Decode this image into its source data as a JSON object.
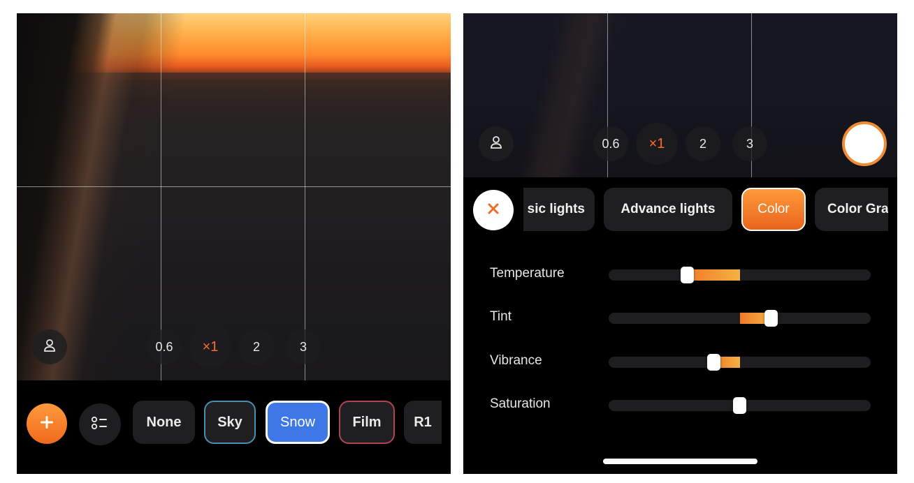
{
  "left": {
    "camera": {
      "user_icon": "person-icon",
      "zoom_levels": [
        "0.6",
        "×1",
        "2",
        "3"
      ],
      "active_zoom": "×1"
    },
    "bottom_bar": {
      "add_icon": "plus-icon",
      "list_icon": "checklist-icon",
      "filters": [
        {
          "label": "None",
          "border": "none"
        },
        {
          "label": "Sky",
          "border": "#4a8fb0"
        },
        {
          "label": "Snow",
          "border": "#ffffff",
          "fill": "#3d78e6"
        },
        {
          "label": "Film",
          "border": "#b04455"
        },
        {
          "label": "R1",
          "border": "none"
        }
      ]
    }
  },
  "right": {
    "camera": {
      "user_icon": "person-icon",
      "zoom_levels": [
        "0.6",
        "×1",
        "2",
        "3"
      ],
      "active_zoom": "×1",
      "shutter_icon": "shutter-button"
    },
    "editor": {
      "close_icon": "close-icon",
      "tabs": [
        "sic lights",
        "Advance lights",
        "Color",
        "Color Gra"
      ],
      "active_tab": "Color",
      "sliders": [
        {
          "label": "Temperature",
          "value": 0.3,
          "fill_from": 0.3,
          "fill_to": 0.5
        },
        {
          "label": "Tint",
          "value": 0.62,
          "fill_from": 0.5,
          "fill_to": 0.62
        },
        {
          "label": "Vibrance",
          "value": 0.4,
          "fill_from": 0.4,
          "fill_to": 0.5
        },
        {
          "label": "Saturation",
          "value": 0.5,
          "fill_from": 0.5,
          "fill_to": 0.5
        }
      ]
    }
  },
  "colors": {
    "accent": "#f07a28",
    "active_zoom_text": "#ff6a2a",
    "snow_fill": "#3d78e6"
  }
}
